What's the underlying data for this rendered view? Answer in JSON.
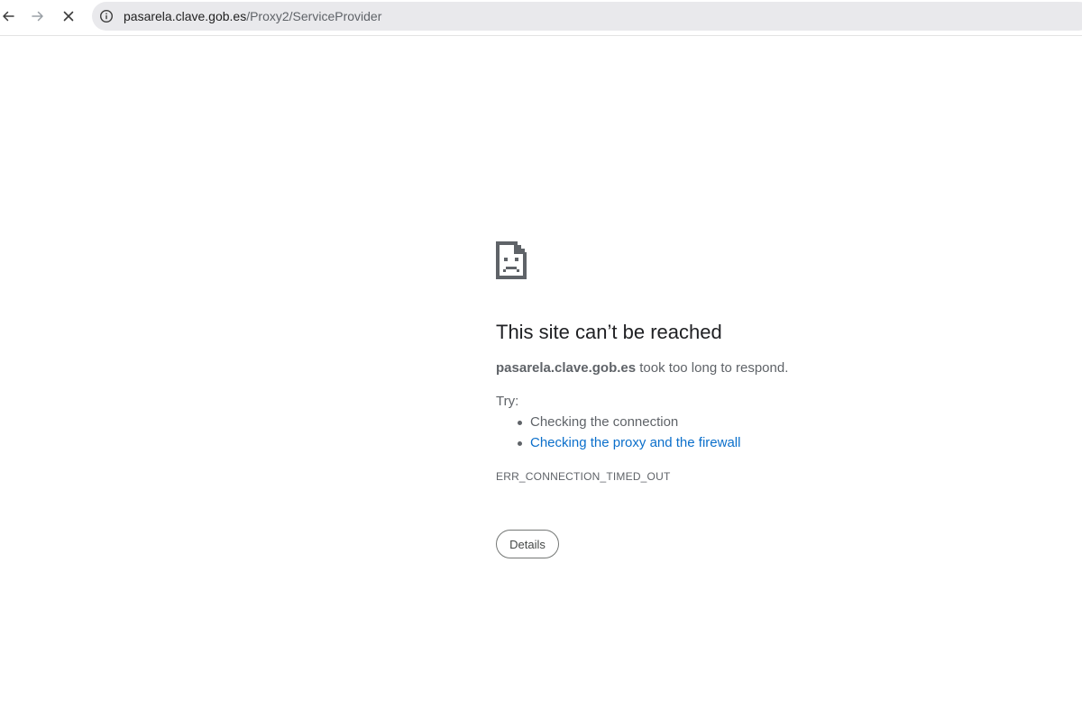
{
  "browser": {
    "url_host": "pasarela.clave.gob.es",
    "url_path": "/Proxy2/ServiceProvider",
    "icons": {
      "back": "arrow-left-icon",
      "forward": "arrow-right-icon",
      "stop": "close-icon",
      "site_info": "info-circle-icon"
    }
  },
  "error_page": {
    "icon": "sad-document-icon",
    "title": "This site can’t be reached",
    "host": "pasarela.clave.gob.es",
    "message": " took too long to respond.",
    "try_label": "Try:",
    "suggestions": [
      "Checking the connection",
      "Checking the proxy and the firewall"
    ],
    "error_code": "ERR_CONNECTION_TIMED_OUT",
    "details_button": "Details"
  },
  "colors": {
    "link": "#0b6fcb",
    "text": "#5f6368",
    "title": "#202124",
    "omnibox": "#e9e9ec"
  }
}
